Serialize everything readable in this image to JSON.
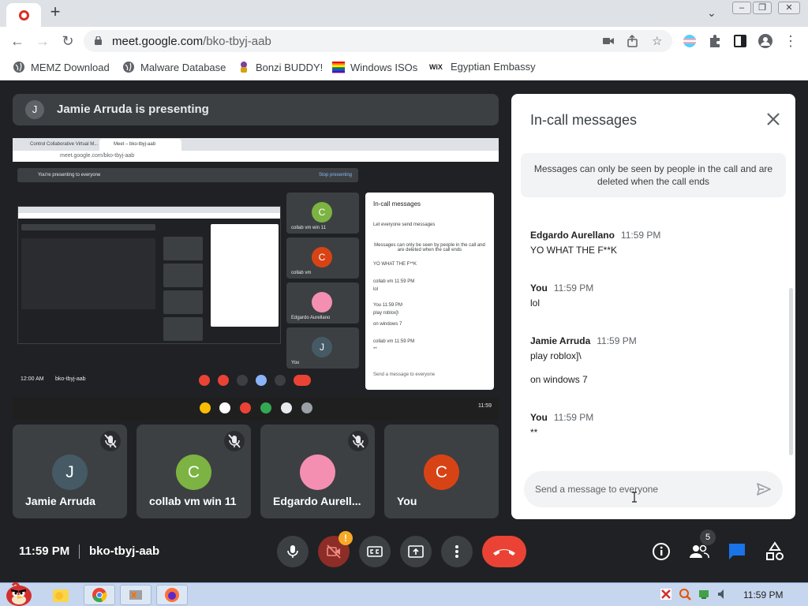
{
  "browser": {
    "url_host": "meet.google.com",
    "url_path": "/bko-tbyj-aab",
    "bookmarks": [
      {
        "label": "MEMZ Download"
      },
      {
        "label": "Malware Database"
      },
      {
        "label": "Bonzi BUDDY!"
      },
      {
        "label": "Windows ISOs"
      },
      {
        "label": "Egyptian Embassy"
      }
    ]
  },
  "meet": {
    "presenting_avatar": "J",
    "presenting_text": "Jamie Arruda is presenting",
    "time": "11:59 PM",
    "meeting_code": "bko-tbyj-aab",
    "people_count": "5",
    "tiles": [
      {
        "initial": "J",
        "name": "Jamie Arruda",
        "color": "#455a64"
      },
      {
        "initial": "C",
        "name": "collab vm win 11",
        "color": "#7cb342"
      },
      {
        "initial": "",
        "name": "Edgardo Aurell...",
        "color": "#f48fb1"
      },
      {
        "initial": "C",
        "name": "You",
        "color": "#d84315"
      }
    ]
  },
  "shared_screen": {
    "tab1": "Control Collaborative Virtual M...",
    "tab2": "Meet – bko-tbyj-aab",
    "url": "meet.google.com/bko-tbyj-aab",
    "banner": "You're presenting to everyone",
    "stop": "Stop presenting",
    "tiles": [
      {
        "initial": "C",
        "name": "collab vm win 11",
        "color": "#7cb342"
      },
      {
        "initial": "C",
        "name": "collab vm",
        "color": "#d84315"
      },
      {
        "initial": "",
        "name": "Edgardo Aurellano",
        "color": "#f48fb1"
      },
      {
        "initial": "J",
        "name": "You",
        "color": "#455a64"
      }
    ],
    "chat_title": "In-call messages",
    "chat_lines": [
      "Let everyone send messages",
      "Messages can only be seen by people in the call and are deleted when the call ends",
      "YO WHAT THE F**K",
      "collab vm  11:59 PM",
      "lol",
      "You  11:59 PM",
      "play roblox]\\",
      "on windows 7",
      "collab vm  11:59 PM",
      "**",
      "Send a message to everyone"
    ],
    "footer_time": "12:00 AM",
    "footer_code": "bko-tbyj-aab",
    "taskbar_time": "11:59"
  },
  "chat": {
    "title": "In-call messages",
    "notice": "Messages can only be seen by people in the call and are deleted when the call ends",
    "placeholder": "Send a message to everyone",
    "messages": [
      {
        "sender": "Edgardo Aurellano",
        "time": "11:59 PM",
        "lines": [
          "YO WHAT THE F**K"
        ]
      },
      {
        "sender": "You",
        "time": "11:59 PM",
        "lines": [
          "lol"
        ]
      },
      {
        "sender": "Jamie Arruda",
        "time": "11:59 PM",
        "lines": [
          "play roblox]\\",
          "on windows 7"
        ]
      },
      {
        "sender": "You",
        "time": "11:59 PM",
        "lines": [
          "**"
        ]
      }
    ]
  },
  "taskbar": {
    "time": "11:59 PM"
  },
  "colors": {
    "end_call": "#ea4335",
    "chat_accent": "#1a73e8",
    "camera_off_badge": "#f9a825"
  }
}
